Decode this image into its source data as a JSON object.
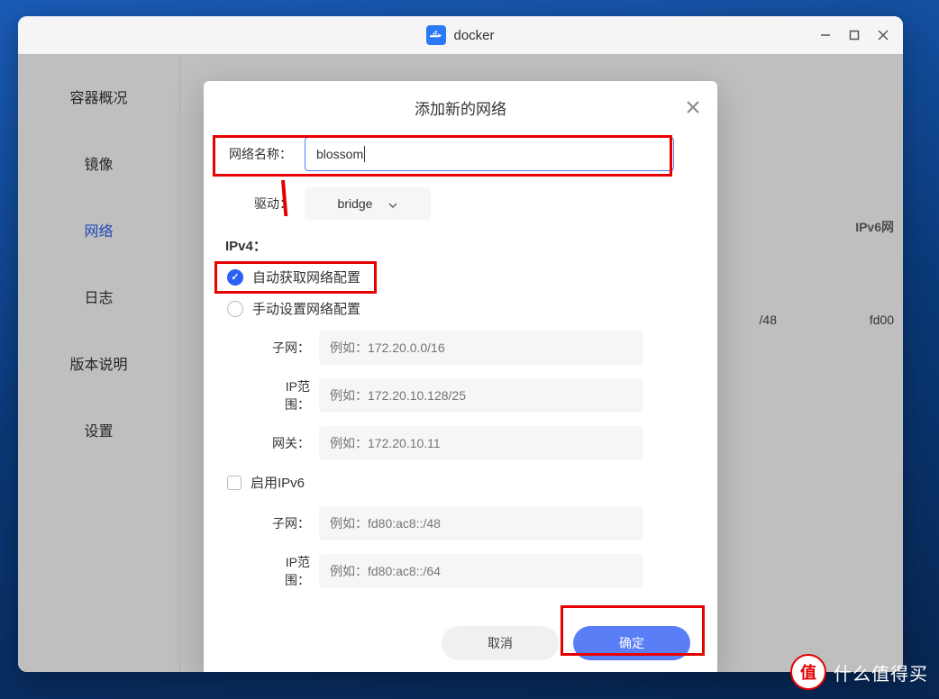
{
  "app": {
    "title": "docker"
  },
  "sidebar": {
    "items": [
      {
        "label": "容器概况"
      },
      {
        "label": "镜像"
      },
      {
        "label": "网络"
      },
      {
        "label": "日志"
      },
      {
        "label": "版本说明"
      },
      {
        "label": "设置"
      }
    ]
  },
  "content": {
    "ipv6_header": "IPv6网",
    "bg_col1": "/48",
    "bg_col2": "fd00"
  },
  "modal": {
    "title": "添加新的网络",
    "name_label": "网络名称：",
    "name_value": "blossom",
    "driver_label": "驱动：",
    "driver_value": "bridge",
    "ipv4_section": "IPv4：",
    "radio_auto": "自动获取网络配置",
    "radio_manual": "手动设置网络配置",
    "subnet_label": "子网：",
    "subnet_ph": "例如：172.20.0.0/16",
    "iprange_label": "IP范围：",
    "iprange_ph": "例如：172.20.10.128/25",
    "gateway_label": "网关：",
    "gateway_ph": "例如：172.20.10.11",
    "ipv6_checkbox": "启用IPv6",
    "subnet6_ph": "例如：fd80:ac8::/48",
    "iprange6_ph": "例如：fd80:ac8::/64",
    "cancel": "取消",
    "confirm": "确定"
  },
  "watermark": {
    "text": "什么值得买",
    "badge": "值"
  }
}
